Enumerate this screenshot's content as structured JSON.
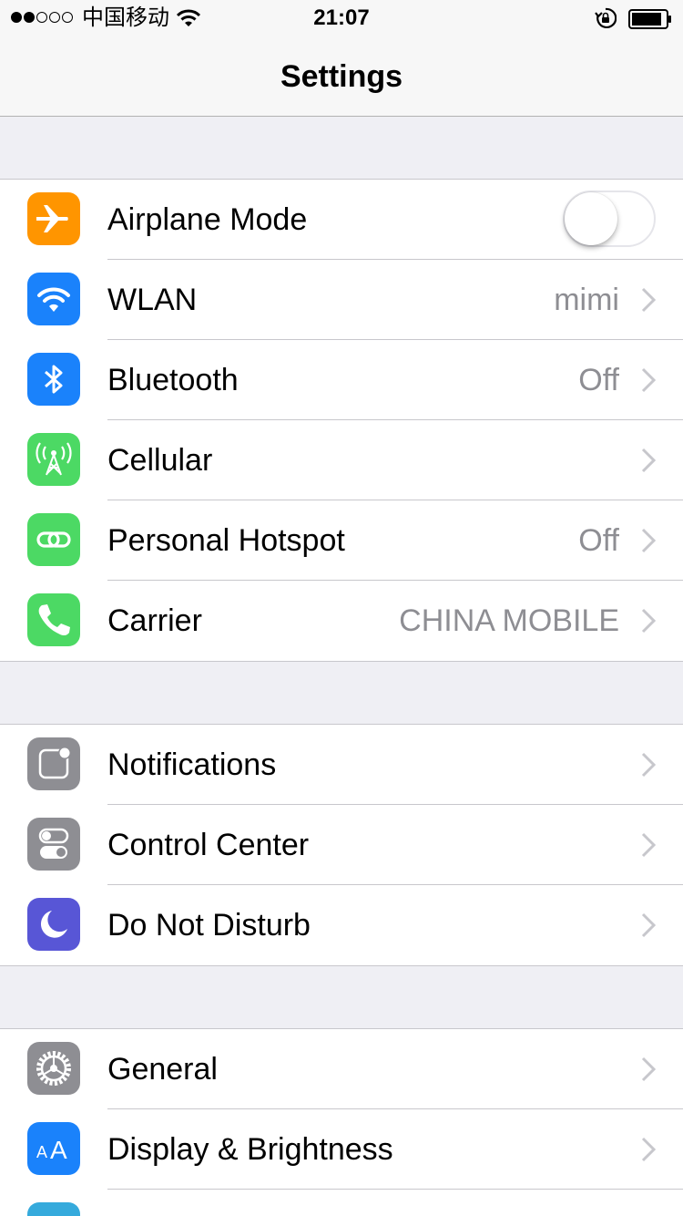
{
  "status_bar": {
    "carrier": "中国移动",
    "time": "21:07",
    "signal_bars_filled": 2,
    "signal_bars_total": 5
  },
  "nav": {
    "title": "Settings"
  },
  "groups": [
    {
      "rows": [
        {
          "label": "Airplane Mode",
          "icon": "airplane-icon",
          "color": "#ff9500",
          "toggle": false
        },
        {
          "label": "WLAN",
          "value": "mimi",
          "icon": "wifi-icon",
          "color": "#1a82fb"
        },
        {
          "label": "Bluetooth",
          "value": "Off",
          "icon": "bluetooth-icon",
          "color": "#1a82fb"
        },
        {
          "label": "Cellular",
          "value": "",
          "icon": "cellular-icon",
          "color": "#4cd964"
        },
        {
          "label": "Personal Hotspot",
          "value": "Off",
          "icon": "hotspot-icon",
          "color": "#4cd964"
        },
        {
          "label": "Carrier",
          "value": "CHINA MOBILE",
          "icon": "phone-icon",
          "color": "#4cd964"
        }
      ]
    },
    {
      "rows": [
        {
          "label": "Notifications",
          "icon": "notifications-icon",
          "color": "#8e8e93"
        },
        {
          "label": "Control Center",
          "icon": "control-center-icon",
          "color": "#8e8e93"
        },
        {
          "label": "Do Not Disturb",
          "icon": "moon-icon",
          "color": "#5856d6"
        }
      ]
    },
    {
      "rows": [
        {
          "label": "General",
          "icon": "gear-icon",
          "color": "#8e8e93"
        },
        {
          "label": "Display & Brightness",
          "icon": "text-size-icon",
          "color": "#1a82fb"
        },
        {
          "label": "",
          "icon": "wallpaper-icon",
          "color": "#35aadc"
        }
      ]
    }
  ],
  "display_icon_text": {
    "small": "A",
    "large": "A"
  }
}
